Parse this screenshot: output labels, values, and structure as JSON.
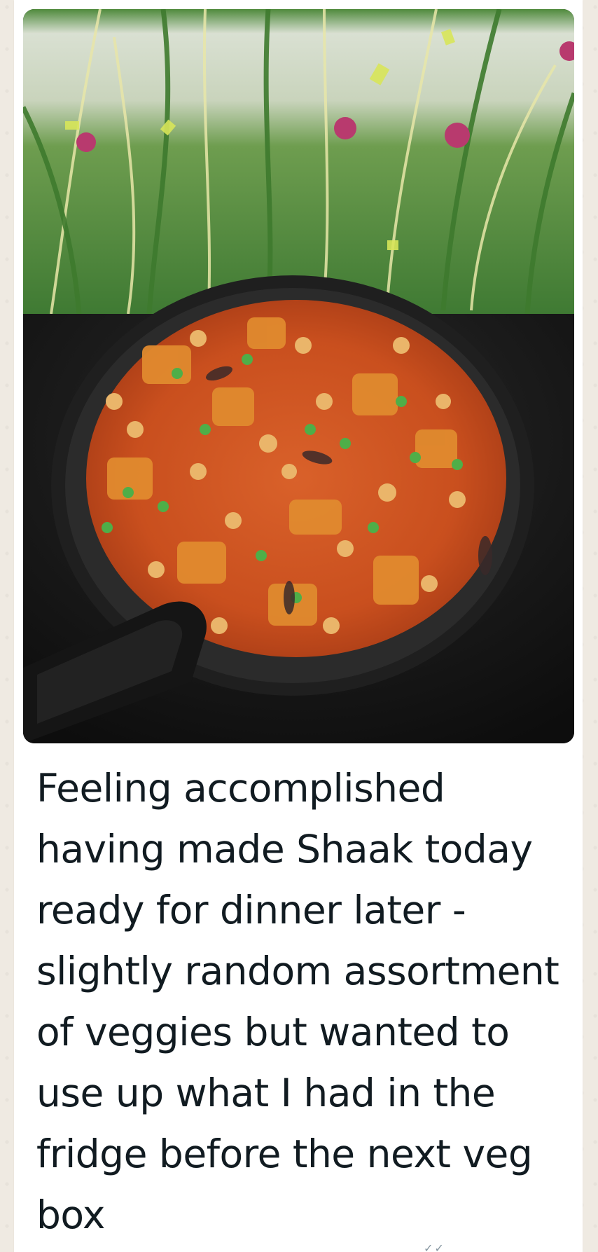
{
  "message": {
    "caption": "Feeling accomplished having made Shaak today ready for dinner later - slightly random assortment of veggies but wanted to use up what I had in the fridge before the next veg box",
    "image_icon": "shaak-curry-photo",
    "status_icon": "message-status-icon"
  },
  "colors": {
    "chat_background": "#efeae2",
    "bubble": "#ffffff",
    "text": "#111b21"
  }
}
